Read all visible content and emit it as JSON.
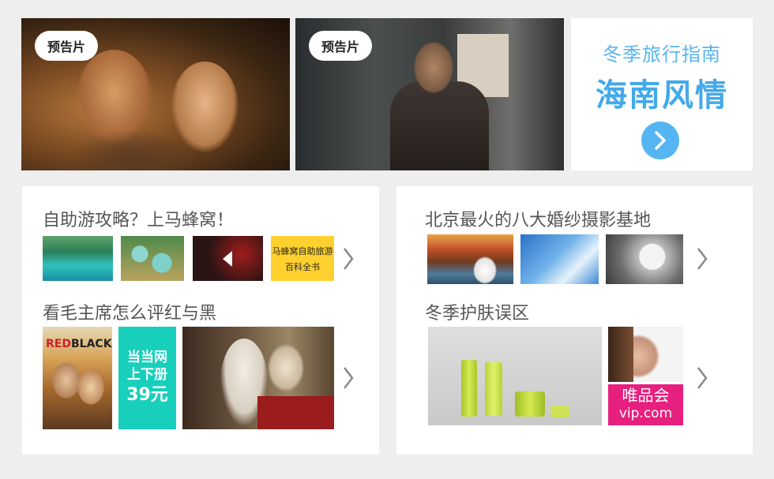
{
  "top": {
    "tile1": {
      "badge": "预告片"
    },
    "tile2": {
      "badge": "预告片"
    },
    "tile3": {
      "subtitle": "冬季旅行指南",
      "title": "海南风情",
      "arrow_icon": "chevron-right-circle-icon"
    }
  },
  "left_panel": {
    "section1": {
      "heading": "自助游攻略？上马蜂窝！",
      "card_line1": "马蜂窝自助旅游",
      "card_line2": "百科全书"
    },
    "section2": {
      "heading": "看毛主席怎么评红与黑",
      "book": {
        "top_text": "RED",
        "sub_text": "BLACK"
      },
      "promo": {
        "line1": "当当网",
        "line2": "上下册",
        "price": "39元"
      }
    }
  },
  "right_panel": {
    "section1": {
      "heading": "北京最火的八大婚纱摄影基地"
    },
    "section2": {
      "heading": "冬季护肤误区",
      "vip_logo_line1": "唯品会",
      "vip_logo_line2": "vip.com"
    }
  },
  "colors": {
    "accent_blue": "#43a9ea",
    "yellow": "#ffd02e",
    "teal": "#18cfbc",
    "vip_pink": "#e7207f"
  }
}
